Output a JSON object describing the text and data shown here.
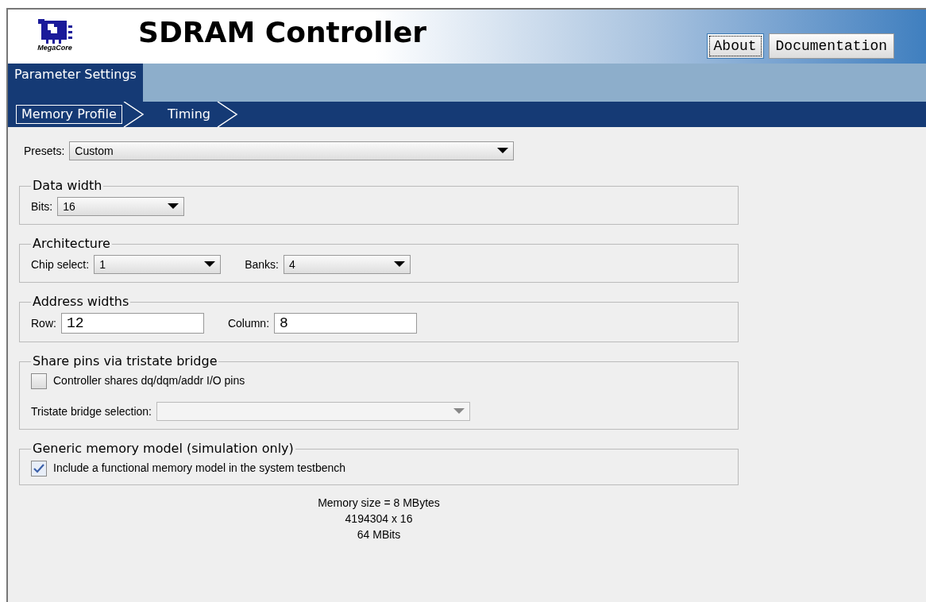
{
  "header": {
    "logo_text": "MegaCore",
    "title": "SDRAM Controller",
    "buttons": [
      {
        "label": "About",
        "focused": true
      },
      {
        "label": "Documentation",
        "focused": false
      }
    ]
  },
  "tabs": [
    {
      "label": "Parameter Settings",
      "selected": true
    }
  ],
  "steps": [
    {
      "label": "Memory Profile",
      "selected": true
    },
    {
      "label": "Timing",
      "selected": false
    }
  ],
  "presets": {
    "label": "Presets:",
    "value": "Custom"
  },
  "groups": [
    {
      "title": "Data width",
      "rows": [
        [
          {
            "kind": "dropdown",
            "label": "Bits:",
            "value": "16",
            "disabled": false
          }
        ]
      ]
    },
    {
      "title": "Architecture",
      "rows": [
        [
          {
            "kind": "dropdown",
            "label": "Chip select:",
            "value": "1",
            "disabled": false
          },
          {
            "kind": "dropdown",
            "label": "Banks:",
            "value": "4",
            "disabled": false
          }
        ]
      ]
    },
    {
      "title": "Address widths",
      "rows": [
        [
          {
            "kind": "text",
            "label": "Row:",
            "value": "12"
          },
          {
            "kind": "text",
            "label": "Column:",
            "value": "8"
          }
        ]
      ]
    },
    {
      "title": "Share pins via tristate bridge",
      "rows": [
        [
          {
            "kind": "checkbox",
            "label": "Controller shares dq/dqm/addr I/O pins",
            "checked": false
          }
        ],
        [
          {
            "kind": "dropdown",
            "label": "Tristate bridge selection:",
            "disabled": true
          }
        ]
      ]
    },
    {
      "title": "Generic memory model (simulation only)",
      "rows": [
        [
          {
            "kind": "checkbox",
            "label": "Include a functional memory model in the system testbench",
            "checked": true
          }
        ]
      ]
    }
  ],
  "summary": [
    "Memory size = 8 MBytes",
    "4194304 x 16",
    "64 MBits"
  ]
}
